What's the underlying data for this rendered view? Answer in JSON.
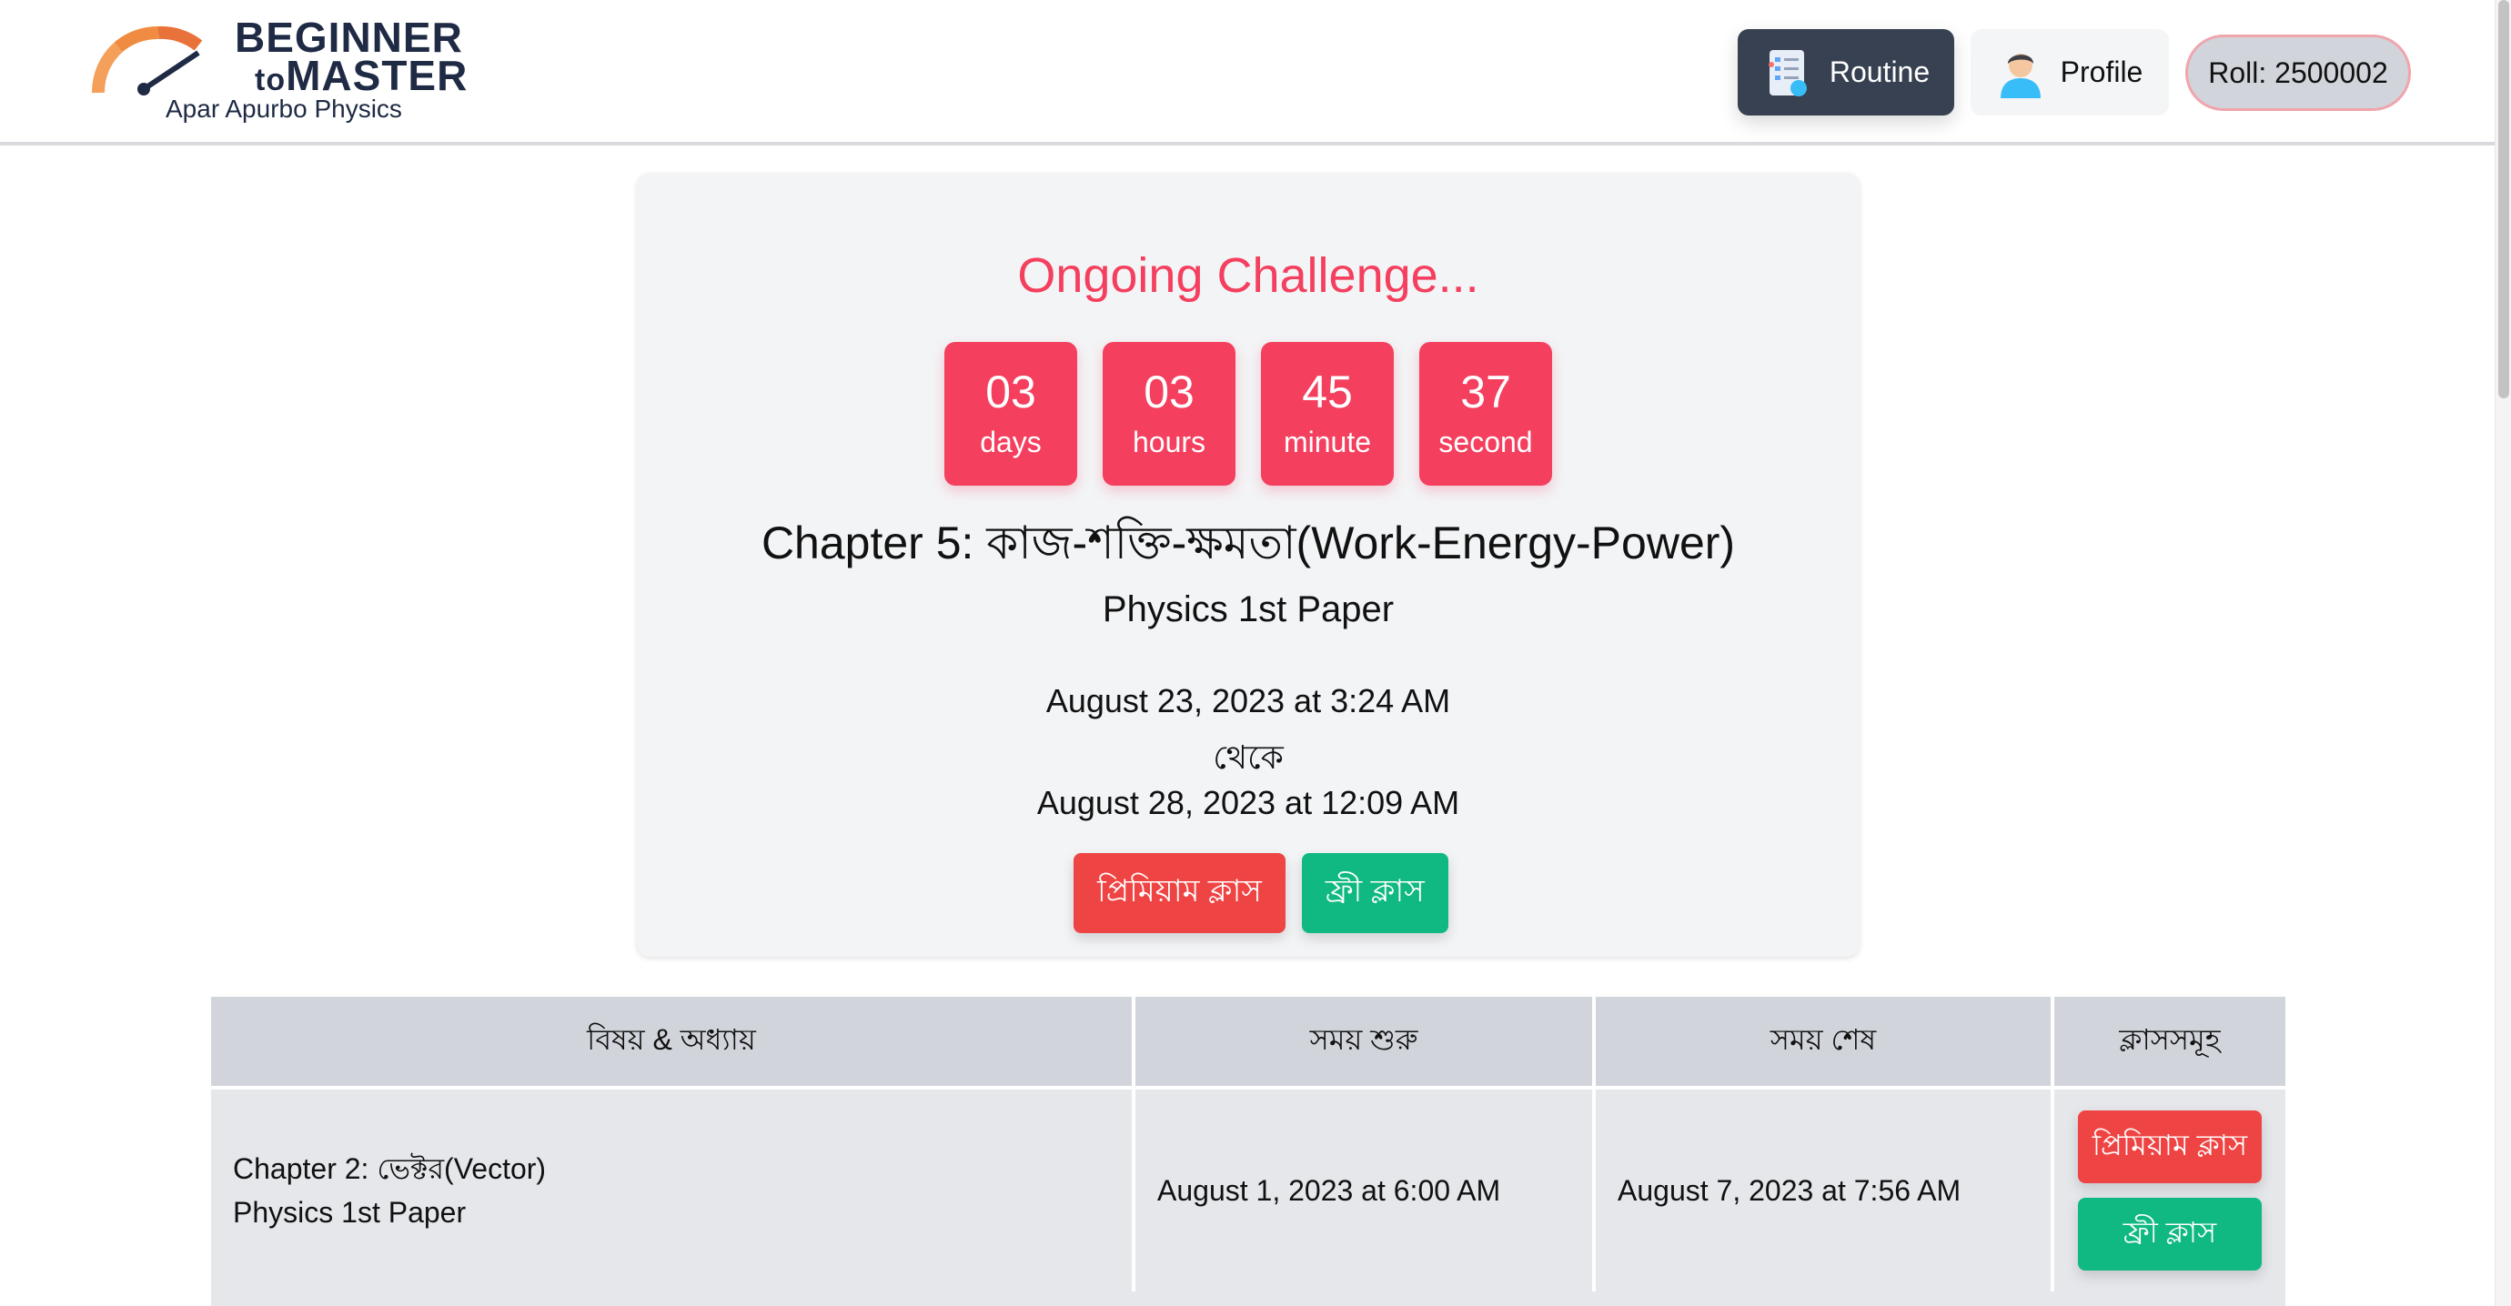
{
  "brand": {
    "title_line1": "BEGINNER",
    "title_line2_prefix": "to",
    "title_line2": "MASTER",
    "subtitle": "Apar Apurbo Physics"
  },
  "nav": {
    "routine_label": "Routine",
    "routine_icon": "routine-document-icon",
    "profile_label": "Profile",
    "profile_icon": "user-avatar-icon",
    "roll_label": "Roll: 2500002"
  },
  "challenge": {
    "heading": "Ongoing Challenge...",
    "countdown": [
      {
        "value": "03",
        "unit": "days"
      },
      {
        "value": "03",
        "unit": "hours"
      },
      {
        "value": "45",
        "unit": "minute"
      },
      {
        "value": "37",
        "unit": "second"
      }
    ],
    "chapter": "Chapter 5: কাজ-শক্তি-ক্ষমতা(Work-Energy-Power)",
    "paper": "Physics 1st Paper",
    "start": "August 23, 2023 at 3:24 AM",
    "connector": "থেকে",
    "end": "August 28, 2023 at 12:09 AM",
    "premium_button": "প্রিমিয়াম ক্লাস",
    "free_button": "ফ্রী ক্লাস"
  },
  "table": {
    "headers": [
      "বিষয় & অধ্যায়",
      "সময় শুরু",
      "সময় শেষ",
      "ক্লাসসমূহ"
    ],
    "rows": [
      {
        "chapter": "Chapter 2: ভেক্টর(Vector)",
        "paper": "Physics 1st Paper",
        "start": "August 1, 2023 at 6:00 AM",
        "end": "August 7, 2023 at 7:56 AM",
        "premium_button": "প্রিমিয়াম ক্লাস",
        "free_button": "ফ্রী ক্লাস"
      }
    ]
  },
  "colors": {
    "accent": "#f43f5e",
    "premium": "#ef4444",
    "free": "#10b981",
    "nav_dark": "#374151"
  }
}
